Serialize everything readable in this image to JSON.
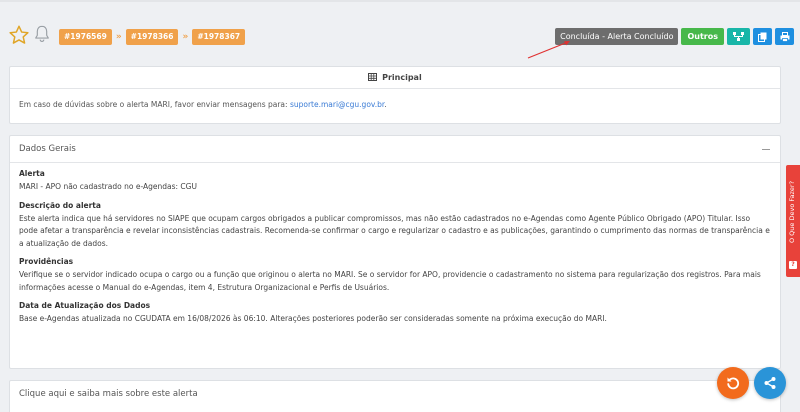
{
  "header": {
    "breadcrumbs": [
      "#1976569",
      "#1978366",
      "#1978367"
    ],
    "separator": "»",
    "status_button": "Concluída - Alerta Concluído",
    "outros_button": "Outros"
  },
  "principal": {
    "title": "Principal",
    "message": "Em caso de dúvidas sobre o alerta MARI, favor enviar mensagens para: ",
    "email": "suporte.mari@cgu.gov.br",
    "message_end": "."
  },
  "dados_gerais": {
    "title": "Dados Gerais",
    "sections": [
      {
        "label": "Alerta",
        "text": "MARI - APO não cadastrado no e-Agendas: CGU"
      },
      {
        "label": "Descrição do alerta",
        "text": "Este alerta indica que há servidores no SIAPE que ocupam cargos obrigados a publicar compromissos, mas não estão cadastrados no e-Agendas como Agente Público Obrigado (APO) Titular. Isso pode afetar a transparência e revelar inconsistências cadastrais. Recomenda-se confirmar o cargo e regularizar o cadastro e as publicações, garantindo o cumprimento das normas de transparência e a atualização de dados."
      },
      {
        "label": "Providências",
        "text": "Verifique se o servidor indicado ocupa o cargo ou a função que originou o alerta no MARI. Se o servidor for APO, providencie o cadastramento no sistema para regularização dos registros. Para mais informações acesse o Manual do e-Agendas, item 4, Estrutura Organizacional e Perfis de Usuários."
      },
      {
        "label": "Data de Atualização dos Dados",
        "text": "Base e-Agendas atualizada no CGUDATA em 16/08/2026 às 06:10. Alterações posteriores poderão ser consideradas somente na próxima execução do MARI."
      }
    ]
  },
  "saiba_mais": {
    "title": "Clique aqui e saiba mais sobre este alerta"
  },
  "side_tab": {
    "label": "O Que Devo Fazer?",
    "icon": "?"
  },
  "colors": {
    "orange": "#f0a14a",
    "green": "#47b84a",
    "teal": "#18b6a8",
    "blue": "#1e8fe0",
    "red": "#e8423a"
  },
  "icons": [
    "star-icon",
    "bell-icon",
    "sitemap-icon",
    "copy-icon",
    "print-icon",
    "table-icon",
    "minus-icon",
    "undo-icon",
    "share-icon"
  ]
}
